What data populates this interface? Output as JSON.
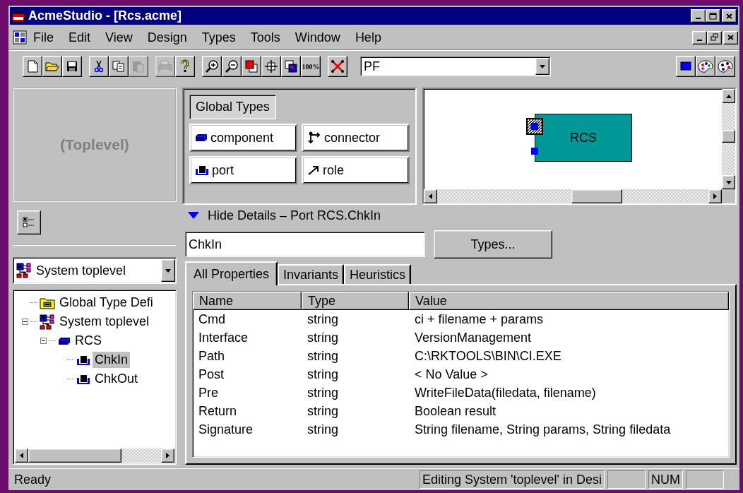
{
  "window": {
    "title": "AcmeStudio - [Rcs.acme]"
  },
  "menu": [
    {
      "label": "File"
    },
    {
      "label": "Edit"
    },
    {
      "label": "View"
    },
    {
      "label": "Design"
    },
    {
      "label": "Types"
    },
    {
      "label": "Tools"
    },
    {
      "label": "Window"
    },
    {
      "label": "Help"
    }
  ],
  "toolbar": [
    {
      "buttons": [
        {
          "kind": "new",
          "disabled": false
        },
        {
          "kind": "open",
          "disabled": false
        },
        {
          "kind": "save",
          "disabled": false
        }
      ]
    },
    {
      "buttons": [
        {
          "kind": "cut",
          "disabled": false
        },
        {
          "kind": "copy",
          "disabled": false
        },
        {
          "kind": "paste",
          "disabled": true
        }
      ]
    },
    {
      "buttons": [
        {
          "kind": "print",
          "disabled": true
        },
        {
          "kind": "help",
          "disabled": false
        }
      ]
    },
    {
      "buttons": [
        {
          "kind": "zoom-in",
          "disabled": false
        },
        {
          "kind": "zoom-out",
          "disabled": false
        },
        {
          "kind": "front",
          "disabled": false
        },
        {
          "kind": "center",
          "disabled": false
        },
        {
          "kind": "back",
          "disabled": false
        },
        {
          "kind": "text",
          "label": "100%",
          "disabled": false
        }
      ]
    },
    {
      "buttons": [
        {
          "kind": "delete",
          "disabled": false
        }
      ]
    }
  ],
  "toolbar_combo": {
    "value": "PF"
  },
  "toolbar_right": [
    {
      "kind": "square",
      "disabled": false
    },
    {
      "kind": "palette",
      "disabled": false
    },
    {
      "kind": "palette-face",
      "disabled": false
    }
  ],
  "toplevel_pane": {
    "label": "(Toplevel)"
  },
  "system_combo": {
    "value": "System toplevel"
  },
  "tree": [
    {
      "label": "Global Type Defi",
      "kind": "folder",
      "selected": false
    },
    {
      "label": "System toplevel",
      "kind": "system",
      "selected": false,
      "expanded": true,
      "children": [
        {
          "label": "RCS",
          "kind": "component",
          "selected": false,
          "expanded": true,
          "children": [
            {
              "label": "ChkIn",
              "kind": "port",
              "selected": true
            },
            {
              "label": "ChkOut",
              "kind": "port",
              "selected": false
            }
          ]
        }
      ]
    }
  ],
  "palette": {
    "title": "Global Types",
    "items": [
      {
        "label": "component",
        "kind": "component"
      },
      {
        "label": "connector",
        "kind": "connector"
      },
      {
        "label": "port",
        "kind": "port"
      },
      {
        "label": "role",
        "kind": "role"
      }
    ]
  },
  "diagram": {
    "components": [
      {
        "label": "RCS",
        "ports": [
          {
            "selected": true
          },
          {
            "selected": false
          }
        ]
      }
    ]
  },
  "details": {
    "header": "Hide Details – Port RCS.ChkIn",
    "name_field": "ChkIn",
    "types_button": "Types...",
    "tabs": [
      {
        "label": "All Properties",
        "selected": true
      },
      {
        "label": "Invariants",
        "selected": false
      },
      {
        "label": "Heuristics",
        "selected": false
      }
    ],
    "table": {
      "columns": [
        "Name",
        "Type",
        "Value"
      ],
      "rows": [
        [
          "Cmd",
          "string",
          "ci + filename + params"
        ],
        [
          "Interface",
          "string",
          "VersionManagement"
        ],
        [
          "Path",
          "string",
          "C:\\RKTOOLS\\BIN\\CI.EXE"
        ],
        [
          "Post",
          "string",
          "< No Value >"
        ],
        [
          "Pre",
          "string",
          "WriteFileData(filedata, filename)"
        ],
        [
          "Return",
          "string",
          "Boolean result"
        ],
        [
          "Signature",
          "string",
          "String filename, String params,  String filedata"
        ]
      ]
    }
  },
  "status_bar": {
    "message": "Ready",
    "panes": [
      "Editing System 'toplevel' in Desi",
      "NUM"
    ]
  }
}
